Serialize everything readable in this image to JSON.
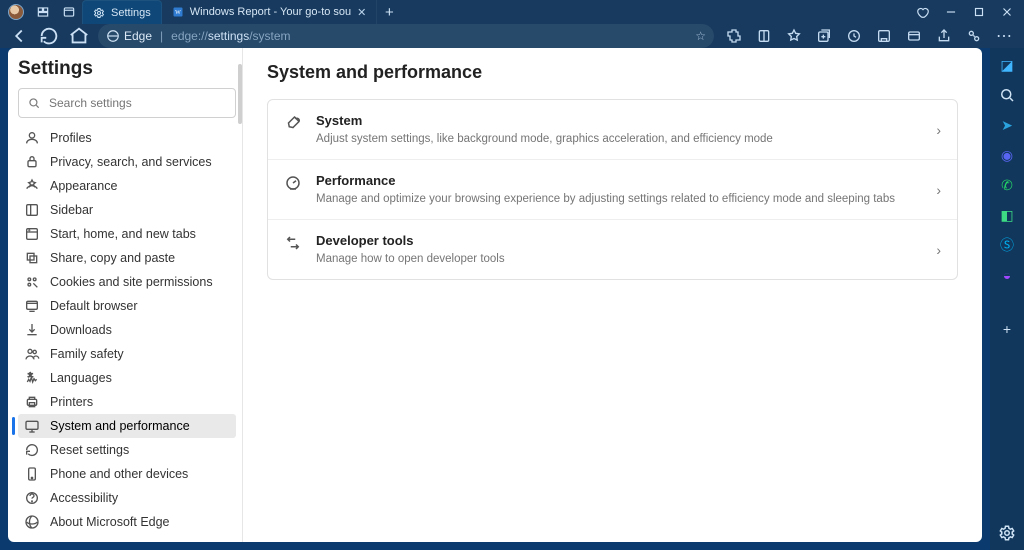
{
  "titlebar": {
    "tabs": [
      {
        "label": "Settings"
      },
      {
        "label": "Windows Report - Your go-to sou"
      }
    ]
  },
  "addressbar": {
    "chip": "Edge",
    "url_prefix": "edge://",
    "url_mid": "settings",
    "url_suffix": "/system"
  },
  "sidebar": {
    "title": "Settings",
    "search_placeholder": "Search settings",
    "items": [
      "Profiles",
      "Privacy, search, and services",
      "Appearance",
      "Sidebar",
      "Start, home, and new tabs",
      "Share, copy and paste",
      "Cookies and site permissions",
      "Default browser",
      "Downloads",
      "Family safety",
      "Languages",
      "Printers",
      "System and performance",
      "Reset settings",
      "Phone and other devices",
      "Accessibility",
      "About Microsoft Edge"
    ],
    "active_index": 12
  },
  "main": {
    "heading": "System and performance",
    "rows": [
      {
        "title": "System",
        "desc": "Adjust system settings, like background mode, graphics acceleration, and efficiency mode"
      },
      {
        "title": "Performance",
        "desc": "Manage and optimize your browsing experience by adjusting settings related to efficiency mode and sleeping tabs"
      },
      {
        "title": "Developer tools",
        "desc": "Manage how to open developer tools"
      }
    ]
  }
}
